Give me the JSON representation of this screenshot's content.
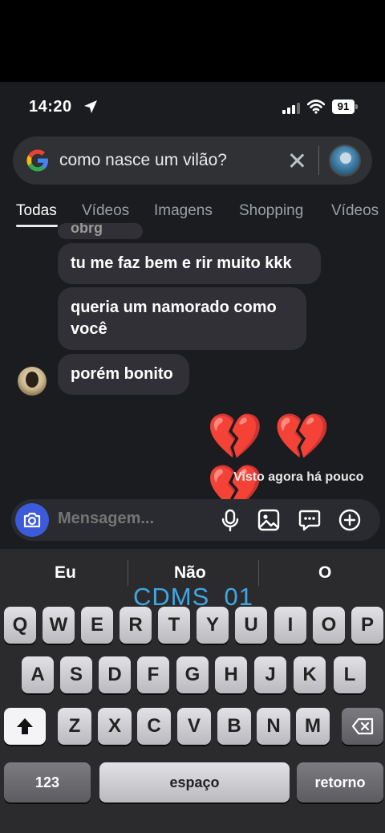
{
  "status_bar": {
    "time": "14:20",
    "battery": "91"
  },
  "search": {
    "query": "como nasce um vilão?"
  },
  "tabs": [
    "Todas",
    "Vídeos",
    "Imagens",
    "Shopping",
    "Vídeos"
  ],
  "chat": {
    "partial_message": "obrg",
    "messages": [
      "tu me faz bem e rir muito kkk",
      "queria um namorado como você",
      "porém bonito"
    ],
    "reactions": "💔💔💔",
    "seen_status": "Visto agora há pouco"
  },
  "composer": {
    "placeholder": "Mensagem..."
  },
  "keyboard": {
    "predictions": [
      "Eu",
      "Não",
      "O"
    ],
    "watermark": "CDMS_01",
    "row1": [
      "Q",
      "W",
      "E",
      "R",
      "T",
      "Y",
      "U",
      "I",
      "O",
      "P"
    ],
    "row2": [
      "A",
      "S",
      "D",
      "F",
      "G",
      "H",
      "J",
      "K",
      "L"
    ],
    "row3": [
      "Z",
      "X",
      "C",
      "V",
      "B",
      "N",
      "M"
    ],
    "numbers_label": "123",
    "space_label": "espaço",
    "return_label": "retorno"
  }
}
